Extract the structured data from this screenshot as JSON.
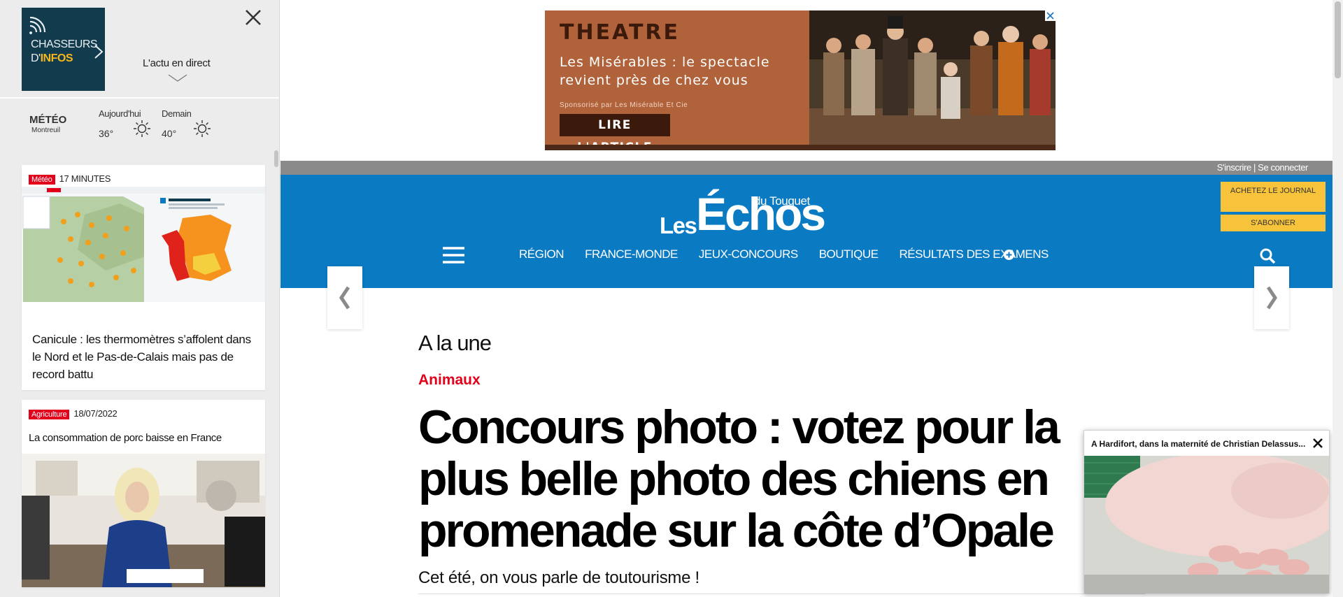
{
  "sidebar": {
    "logo": {
      "line1": "CHASSEURS",
      "line2a": "D'",
      "line2b": "INFOS"
    },
    "live_label": "L'actu en direct",
    "meteo": {
      "title": "MÉTÉO",
      "city": "Montreuil",
      "today_label": "Aujourd'hui",
      "today_temp": "36°",
      "tomorrow_label": "Demain",
      "tomorrow_temp": "40°",
      "today_icon": "sun-icon",
      "tomorrow_icon": "sun-icon"
    },
    "cards": [
      {
        "tag": "Météo",
        "time": "17 MINUTES",
        "title": "Canicule : les thermomètres s’affolent dans le Nord et le Pas-de-Calais mais pas de record battu"
      },
      {
        "tag": "Agriculture",
        "time": "18/07/2022",
        "title": "La consommation de porc baisse en France"
      }
    ]
  },
  "ad": {
    "category": "THEATRE",
    "headline": "Les Misérables : le spectacle revient près de chez vous",
    "sponsor": "Sponsorisé par Les Misérable Et Cie",
    "cta": "LIRE L'ARTICLE"
  },
  "topbar": {
    "login": "S'inscrire | Se connecter"
  },
  "header": {
    "brand_les": "Les",
    "brand_echos": "Échos",
    "brand_du": "du Touquet",
    "menu": [
      "RÉGION",
      "FRANCE-MONDE",
      "JEUX-CONCOURS",
      "BOUTIQUE",
      "RÉSULTATS DES EXAMENS"
    ],
    "buy_label": "ACHETEZ LE JOURNAL",
    "subscribe_label": "S'ABONNER"
  },
  "article": {
    "section": "A la une",
    "rubric": "Animaux",
    "headline": "Concours photo : votez pour la plus belle photo des chiens en promenade sur la côte d’Opale",
    "lede": "Cet été, on vous parle de toutourisme !"
  },
  "miniplayer": {
    "caption": "A Hardifort, dans la maternité de Christian Delassus..."
  },
  "colors": {
    "brand_blue": "#0a7ac3",
    "accent_red": "#e2001a",
    "cta_yellow": "#f7c33b",
    "logo_navy": "#123b4d"
  }
}
